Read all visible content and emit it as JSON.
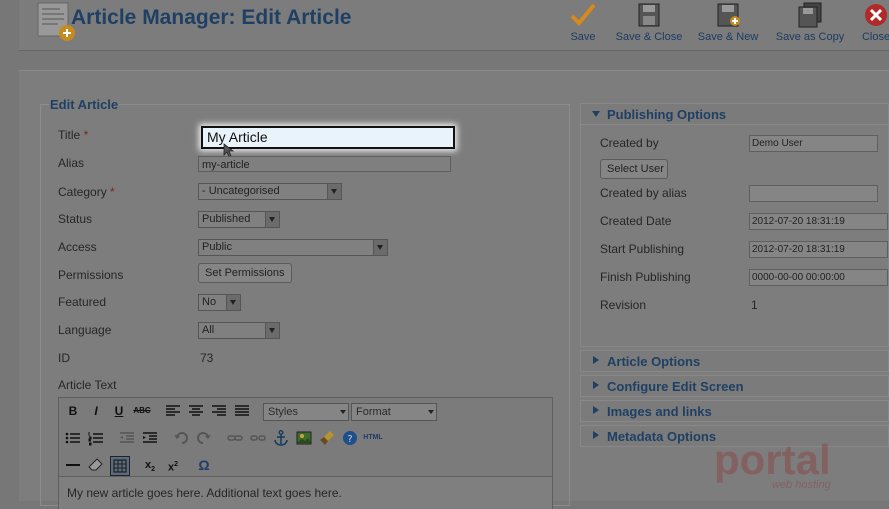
{
  "header": {
    "title": "Article Manager: Edit Article",
    "toolbar": [
      {
        "label": "Save",
        "icon": "check-icon"
      },
      {
        "label": "Save & Close",
        "icon": "floppy-icon"
      },
      {
        "label": "Save & New",
        "icon": "floppy-plus-icon"
      },
      {
        "label": "Save as Copy",
        "icon": "floppy-copy-icon"
      },
      {
        "label": "Close",
        "icon": "close-icon"
      }
    ]
  },
  "form": {
    "legend": "Edit Article",
    "title_label": "Title",
    "title_value": "My Article",
    "alias_label": "Alias",
    "alias_value": "my-article",
    "category_label": "Category",
    "category_value": "- Uncategorised",
    "status_label": "Status",
    "status_value": "Published",
    "access_label": "Access",
    "access_value": "Public",
    "permissions_label": "Permissions",
    "permissions_button": "Set Permissions",
    "featured_label": "Featured",
    "featured_value": "No",
    "language_label": "Language",
    "language_value": "All",
    "id_label": "ID",
    "id_value": "73",
    "text_label": "Article Text",
    "required_mark": "*"
  },
  "editor": {
    "styles_label": "Styles",
    "format_label": "Format",
    "html_label": "HTML",
    "body_text": "My new article goes here. Additional text goes here."
  },
  "publishing": {
    "heading": "Publishing Options",
    "created_by_label": "Created by",
    "created_by_value": "Demo User",
    "select_user_button": "Select User",
    "created_by_alias_label": "Created by alias",
    "created_by_alias_value": "",
    "created_date_label": "Created Date",
    "created_date_value": "2012-07-20 18:31:19",
    "start_publishing_label": "Start Publishing",
    "start_publishing_value": "2012-07-20 18:31:19",
    "finish_publishing_label": "Finish Publishing",
    "finish_publishing_value": "0000-00-00 00:00:00",
    "revision_label": "Revision",
    "revision_value": "1"
  },
  "accordion": [
    "Article Options",
    "Configure Edit Screen",
    "Images and links",
    "Metadata Options"
  ],
  "watermark": {
    "brand": "portal",
    "tagline": "web hosting"
  },
  "colors": {
    "accent": "#1f4064",
    "check": "#e08c1a",
    "close": "#b4272a"
  }
}
